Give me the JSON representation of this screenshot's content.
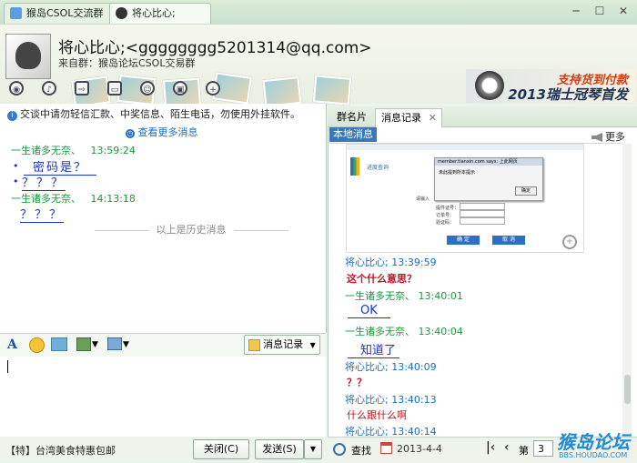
{
  "tabs": [
    {
      "label": "猴岛CSOL交流群"
    },
    {
      "label": "将心比心;"
    }
  ],
  "window": {
    "minimize": "─",
    "maximize": "☐",
    "close": "✕"
  },
  "contact": {
    "name": "将心比心;<gggggggg5201314@qq.com>",
    "source": "来自群：猴岛论坛CSOL交易群"
  },
  "ad": {
    "line1": "支持货到付款",
    "line2": "2013瑞士冠琴首发"
  },
  "notice": "交谈中请勿轻信汇款、中奖信息、陌生电话，勿使用外挂软件。",
  "more_messages": "查看更多消息",
  "left_messages": [
    {
      "sender": "一生诸多无奈、",
      "time": "13:59:24",
      "text": "密码是？"
    },
    {
      "text": "？？？"
    },
    {
      "sender": "一生诸多无奈、",
      "time": "14:13:18",
      "text": "？？？"
    }
  ],
  "history_divider": "以上是历史消息",
  "message_log_button": "消息记录",
  "ticker": "【特】台湾美食特惠包邮",
  "close_button": "关闭(C)",
  "send_button": "发送(S)",
  "right_tabs": [
    "群名片",
    "消息记录"
  ],
  "local_messages": "本地消息",
  "more_button": "更多",
  "embedded_screenshot": {
    "dialog_title": "member.tianxin.com says: 上此网页",
    "dialog_text": "未此提到所本提示",
    "ok_label": "确定",
    "form_labels": [
      "请输入",
      "提件证号：",
      "订单号：",
      "验证码："
    ],
    "button_confirm": "确 定",
    "button_cancel": "取 消",
    "logo_text": "进度查询"
  },
  "right_messages": [
    {
      "name": "将心比心;",
      "time": "13:39:59",
      "text": "这个什么意思？",
      "style": "red"
    },
    {
      "name": "一生诸多无奈、",
      "time": "13:40:01",
      "text": "OK",
      "style": "blue"
    },
    {
      "name": "一生诸多无奈、",
      "time": "13:40:04",
      "text": "知道了",
      "style": "blue"
    },
    {
      "name": "将心比心;",
      "time": "13:40:09",
      "text": "？？",
      "style": "red"
    },
    {
      "name": "将心比心;",
      "time": "13:40:13",
      "text": "什么跟什么啊",
      "style": "red"
    },
    {
      "name": "将心比心;",
      "time": "13:40:14",
      "text": "",
      "style": "red"
    }
  ],
  "search_label": "查找",
  "date_label": "2013-4-4",
  "page_label": "第",
  "page_number": "3",
  "watermark": {
    "line1": "猴岛论坛",
    "line2": "BBS.HOUDAO.COM"
  }
}
